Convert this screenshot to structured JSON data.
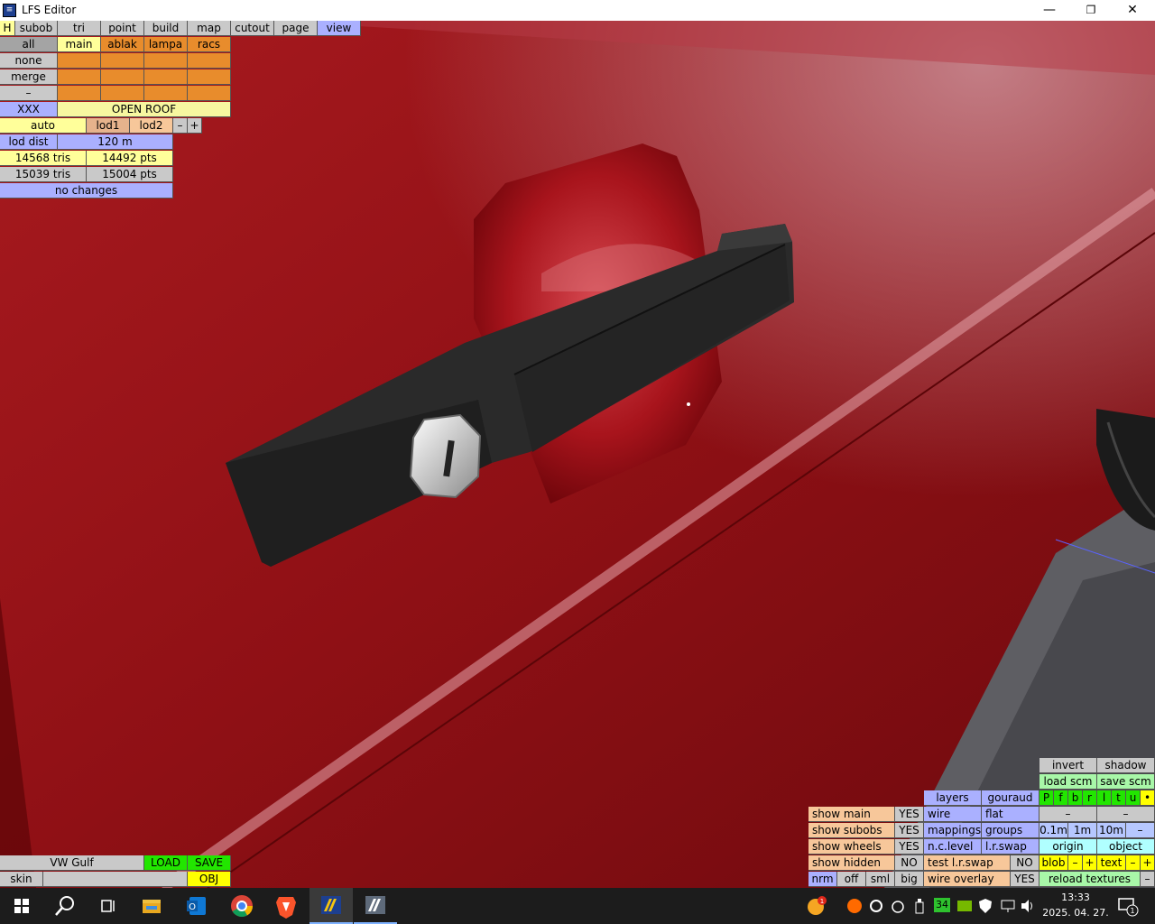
{
  "window": {
    "title": "LFS Editor",
    "app_icon": "lfs-icon",
    "controls": {
      "minimize": "—",
      "restore": "❐",
      "close": "✕"
    }
  },
  "menu": {
    "h": "H",
    "tabs": [
      "subob",
      "tri",
      "point",
      "build",
      "map",
      "cutout",
      "page",
      "view"
    ],
    "active_tab": "view"
  },
  "subobjects": {
    "side_buttons": [
      "all",
      "none",
      "merge",
      "–"
    ],
    "columns": [
      "main",
      "ablak",
      "lampa",
      "racs"
    ],
    "xxx": "XXX",
    "open_roof": "OPEN ROOF"
  },
  "lod": {
    "auto": "auto",
    "lod1": "lod1",
    "lod2": "lod2",
    "minus": "–",
    "plus": "+",
    "lod_dist_label": "lod dist",
    "lod_dist_value": "120 m",
    "tris1": "14568 tris",
    "pts1": "14492 pts",
    "tris2": "15039 tris",
    "pts2": "15004 pts",
    "changes": "no changes"
  },
  "bottom_left": {
    "car_name": "VW Gulf",
    "load": "LOAD",
    "save": "SAVE",
    "skin": "skin",
    "skin_value": "",
    "obj": "OBJ"
  },
  "view_panel": {
    "invert": "invert",
    "shadow": "shadow",
    "load_scm": "load scm",
    "save_scm": "save scm",
    "letters": [
      "P",
      "f",
      "b",
      "r",
      "l",
      "t",
      "u",
      "•"
    ],
    "dash": "–",
    "layers": "layers",
    "gouraud": "gouraud",
    "wire": "wire",
    "flat": "flat",
    "mappings": "mappings",
    "groups": "groups",
    "ncl": "n.c.level",
    "lrswap": "l.r.swap",
    "test_lrswap": "test l.r.swap",
    "wire_overlay": "wire overlay",
    "show_main": "show main",
    "show_subobs": "show subobs",
    "show_wheels": "show wheels",
    "show_hidden": "show hidden",
    "yes": "YES",
    "no": "NO",
    "grid": [
      "0.1m",
      "1m",
      "10m",
      "–"
    ],
    "origin": "origin",
    "object": "object",
    "blob": "blob",
    "text": "text",
    "minus": "–",
    "plus": "+",
    "nrm": "nrm",
    "off": "off",
    "sml": "sml",
    "big": "big",
    "reload_textures": "reload textures"
  },
  "taskbar": {
    "time": "13:33",
    "date": "2025. 04. 27.",
    "badge_number": "34",
    "notification_count": "1",
    "notification_badge": "1"
  },
  "colors": {
    "body_red": "#8d0f14",
    "handle": "#2a2a2a",
    "taskbar": "#1c1c1c"
  }
}
